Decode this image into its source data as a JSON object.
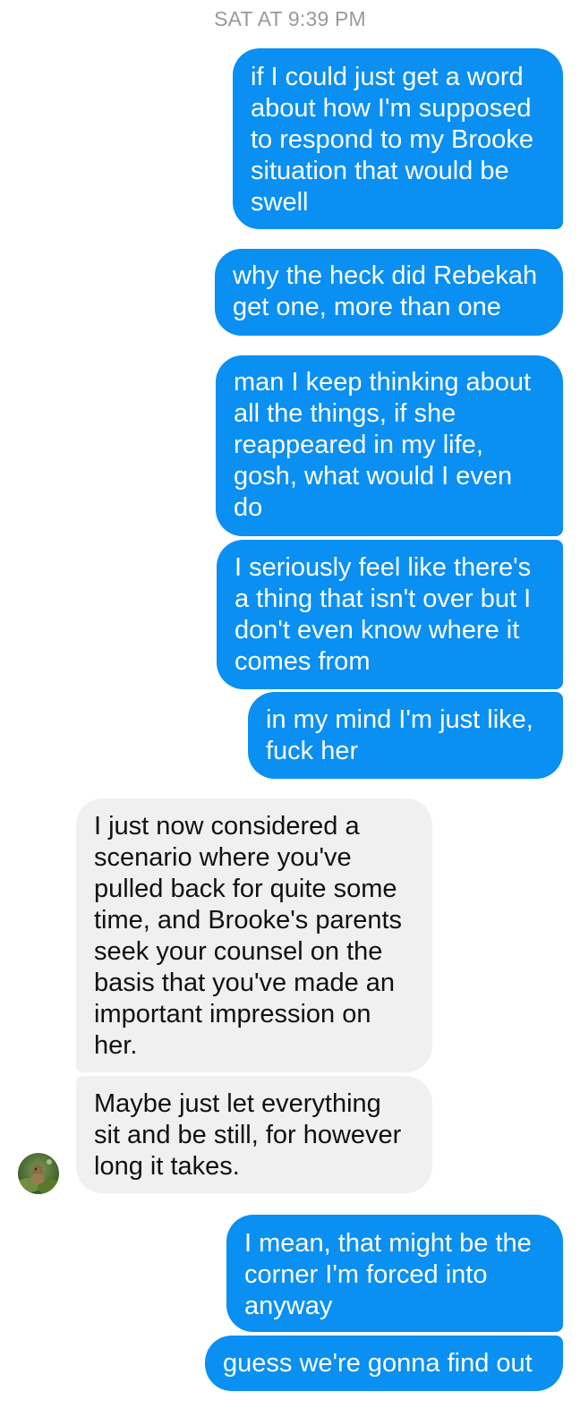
{
  "conversation": {
    "timestamp": "SAT AT 9:39 PM",
    "messages": [
      {
        "sender": "me",
        "text": "if I could just get a word\nabout how I'm supposed\nto respond to my Brooke\nsituation that would be\nswell"
      },
      {
        "sender": "me",
        "text": "why the heck did Rebekah\nget one, more than one"
      },
      {
        "sender": "me",
        "text": "man I keep thinking about\nall the things, if she\nreappeared in my life,\ngosh, what would I even\ndo"
      },
      {
        "sender": "me",
        "text": "I seriously feel like there's\na thing that isn't over but I\ndon't even know where it\ncomes from"
      },
      {
        "sender": "me",
        "text": "in my mind I'm just like,\nfuck her"
      },
      {
        "sender": "them",
        "text": "I just now considered a\nscenario where you've\npulled back for quite some\ntime, and Brooke's parents\nseek your counsel on the\nbasis that you've made an\nimportant impression on\nher."
      },
      {
        "sender": "them",
        "text": "Maybe just let everything\nsit and be still, for however\nlong it takes."
      },
      {
        "sender": "me",
        "text": "I mean, that might be the\ncorner I'm forced into\nanyway"
      },
      {
        "sender": "me",
        "text": "guess we're gonna find out"
      }
    ]
  },
  "colors": {
    "outgoing_bubble": "#0a8ff2",
    "incoming_bubble": "#f0f0f0",
    "timestamp_text": "#9a9a9a"
  },
  "icons": {
    "contact_avatar": "contact-avatar-photo"
  }
}
